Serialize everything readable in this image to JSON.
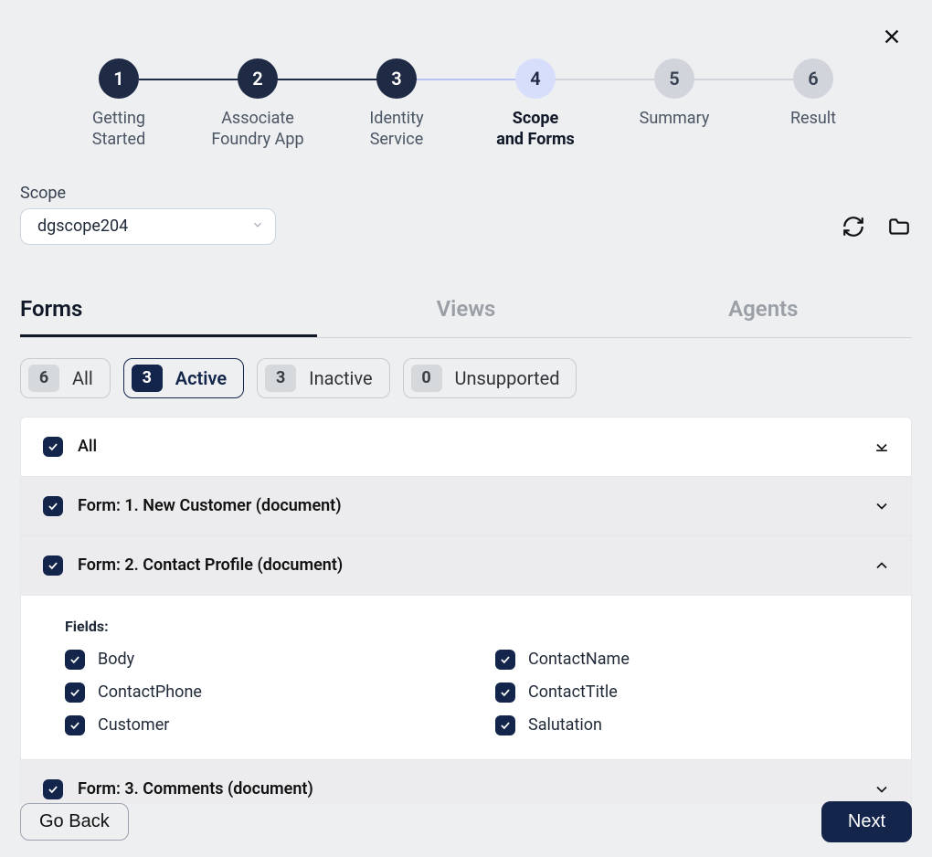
{
  "close_label": "Close",
  "stepper": {
    "steps": [
      {
        "num": "1",
        "label": "Getting\nStarted",
        "state": "done"
      },
      {
        "num": "2",
        "label": "Associate\nFoundry App",
        "state": "done"
      },
      {
        "num": "3",
        "label": "Identity\nService",
        "state": "done"
      },
      {
        "num": "4",
        "label": "Scope\nand Forms",
        "state": "current"
      },
      {
        "num": "5",
        "label": "Summary",
        "state": "later"
      },
      {
        "num": "6",
        "label": "Result",
        "state": "later"
      }
    ]
  },
  "scope": {
    "label": "Scope",
    "selected": "dgscope204"
  },
  "tabs": [
    {
      "label": "Forms",
      "active": true
    },
    {
      "label": "Views",
      "active": false
    },
    {
      "label": "Agents",
      "active": false
    }
  ],
  "filters": [
    {
      "count": "6",
      "label": "All",
      "active": false
    },
    {
      "count": "3",
      "label": "Active",
      "active": true
    },
    {
      "count": "3",
      "label": "Inactive",
      "active": false
    },
    {
      "count": "0",
      "label": "Unsupported",
      "active": false
    }
  ],
  "list": {
    "all_label": "All",
    "rows": [
      {
        "label": "Form: 1. New Customer (document)",
        "expanded": false
      },
      {
        "label": "Form: 2. Contact Profile (document)",
        "expanded": true
      },
      {
        "label": "Form: 3. Comments (document)",
        "expanded": false
      }
    ],
    "fields_title": "Fields:",
    "fields_left": [
      "Body",
      "ContactPhone",
      "Customer"
    ],
    "fields_right": [
      "ContactName",
      "ContactTitle",
      "Salutation"
    ]
  },
  "footer": {
    "back": "Go Back",
    "next": "Next"
  }
}
